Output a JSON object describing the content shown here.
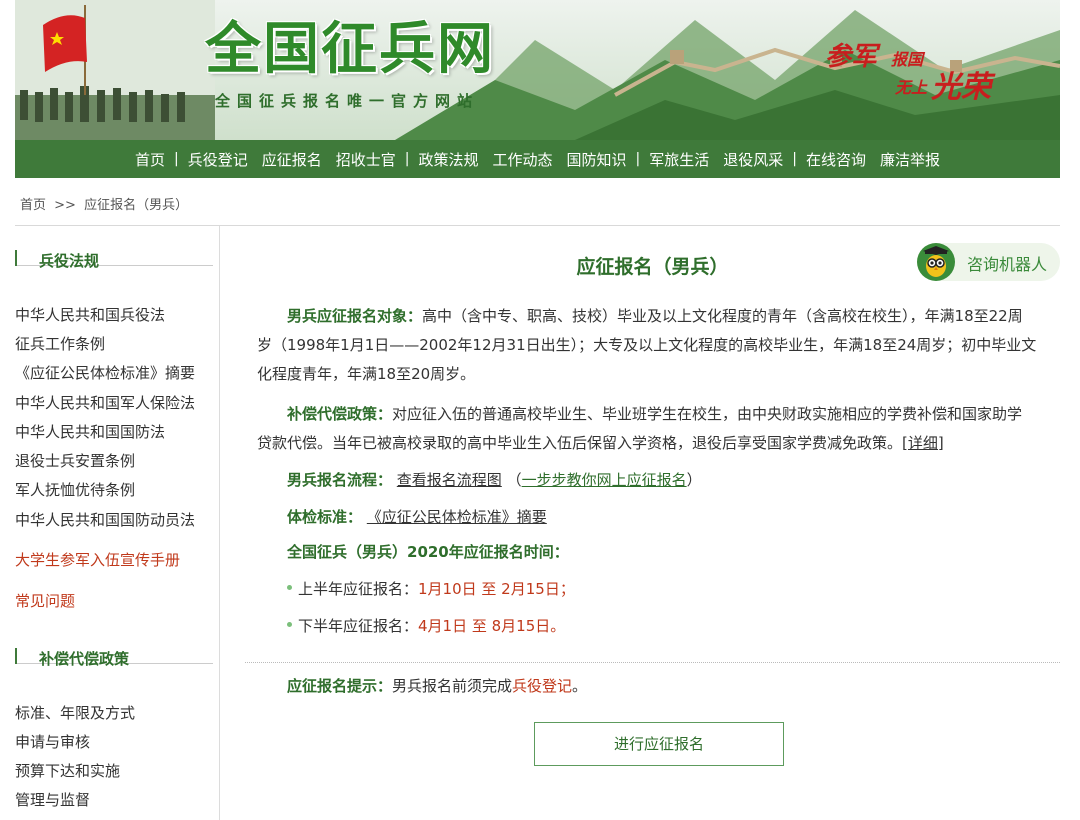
{
  "banner": {
    "title": "全国征兵网",
    "subtitle": "全国征兵报名唯一官方网站",
    "slogan": [
      "参军",
      "报国",
      "无上",
      "光荣"
    ]
  },
  "nav": {
    "items": [
      "首页",
      "兵役登记",
      "应征报名",
      "招收士官",
      "政策法规",
      "工作动态",
      "国防知识",
      "军旅生活",
      "退役风采",
      "在线咨询",
      "廉洁举报"
    ],
    "separator": "|"
  },
  "breadcrumb": {
    "home": "首页",
    "sep": ">>",
    "current": "应征报名（男兵）"
  },
  "sidebar": {
    "section1": {
      "title": "兵役法规",
      "items": [
        "中华人民共和国兵役法",
        "征兵工作条例",
        "《应征公民体检标准》摘要",
        "中华人民共和国军人保险法",
        "中华人民共和国国防法",
        "退役士兵安置条例",
        "军人抚恤优待条例",
        "中华人民共和国国防动员法"
      ]
    },
    "hot_links": [
      "大学生参军入伍宣传手册",
      "常见问题"
    ],
    "section2": {
      "title": "补偿代偿政策",
      "items": [
        "标准、年限及方式",
        "申请与审核",
        "预算下达和实施",
        "管理与监督"
      ]
    }
  },
  "main": {
    "title": "应征报名（男兵）",
    "robot_label": "咨询机器人",
    "target_label": "男兵应征报名对象：",
    "target_line1": "高中（含中专、职高、技校）毕业及以上文化程度的青年（含高校在校生），年满18至22周",
    "target_line2": "岁（1998年1月1日——2002年12月31日出生）；大专及以上文化程度的高校毕业生，年满18至24周岁；初中毕业文",
    "target_line3": "化程度青年，年满18至20周岁。",
    "comp_label": "补偿代偿政策：",
    "comp_line1": "对应征入伍的普通高校毕业生、毕业班学生在校生，由中央财政实施相应的学费补偿和国家助学",
    "comp_line2": "贷款代偿。当年已被高校录取的高中毕业生入伍后保留入学资格，退役后享受国家学费减免政策。",
    "comp_detail": "[详细]",
    "process_label": "男兵报名流程：",
    "process_link": "查看报名流程图",
    "process_paren_open": "（",
    "process_link2": "一步步教你网上应征报名",
    "process_paren_close": "）",
    "exam_label": "体检标准：",
    "exam_link": "《应征公民体检标准》摘要",
    "time_heading": "全国征兵（男兵）2020年应征报名时间：",
    "first_half_label": "上半年应征报名：",
    "first_half_value": "1月10日 至 2月15日；",
    "second_half_label": "下半年应征报名：",
    "second_half_value": "4月1日 至 8月15日。",
    "tip_label": "应征报名提示：",
    "tip_text": "男兵报名前须完成",
    "tip_link": "兵役登记",
    "tip_end": "。",
    "apply_button": "进行应征报名"
  },
  "colors": {
    "brand_green": "#3f7a3a",
    "title_green": "#2f6e2c",
    "accent_red": "#c0391b"
  }
}
